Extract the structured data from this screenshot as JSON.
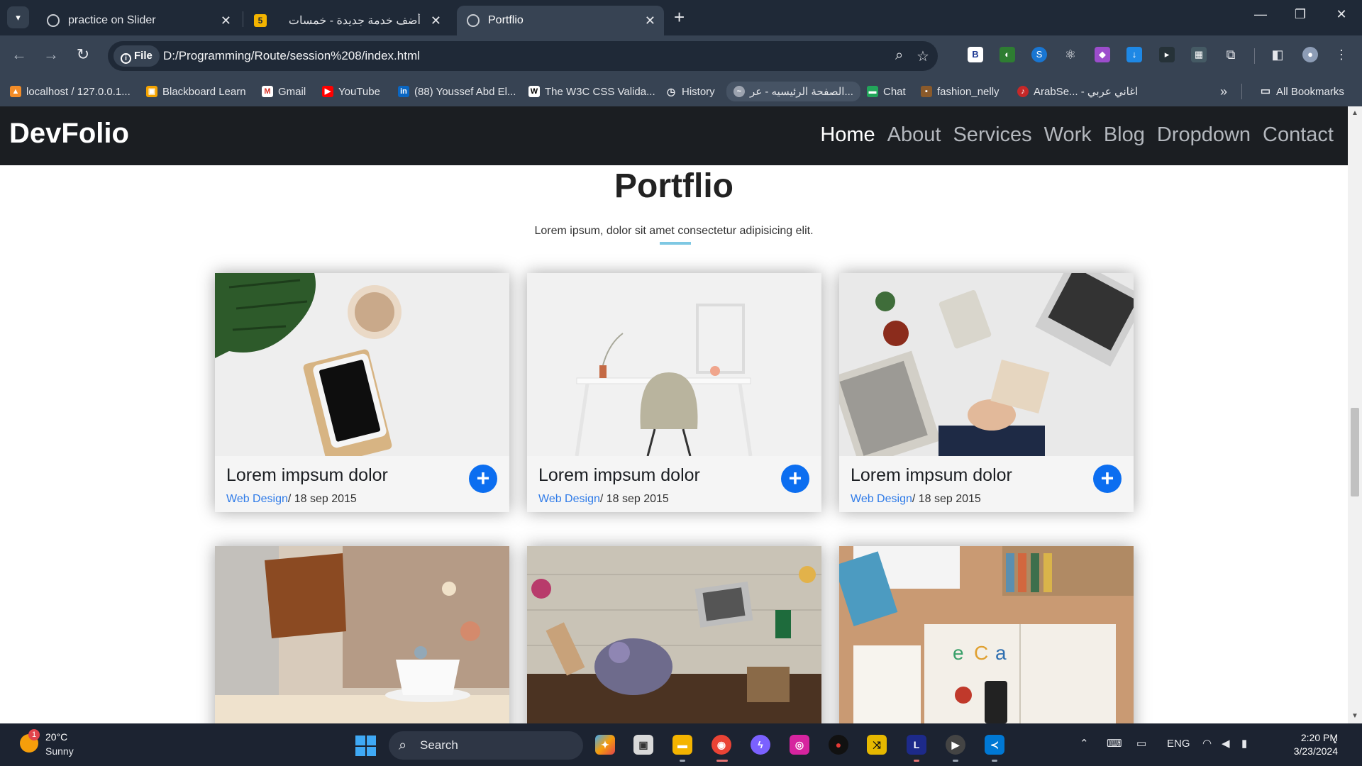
{
  "browser": {
    "tabs": [
      {
        "title": "practice on Slider",
        "active": false
      },
      {
        "title": "أضف خدمة جديدة - خمسات",
        "active": false
      },
      {
        "title": "Portflio",
        "active": true
      }
    ],
    "favicon_five": "5",
    "new_tab_symbol": "+",
    "url_chip": "File",
    "url": "D:/Programming/Route/session%208/index.html",
    "bookmarks": [
      "localhost / 127.0.0.1...",
      "Blackboard Learn",
      "Gmail",
      "YouTube",
      "(88) Youssef Abd El...",
      "The W3C CSS Valida...",
      "History",
      "الصفحة الرئيسيه - عر...",
      "Chat",
      "fashion_nelly",
      "ArabSe... - اغاني عربي"
    ],
    "all_bookmarks": "All Bookmarks",
    "extension_letter_b": "B"
  },
  "site": {
    "logo": "DevFolio",
    "nav": [
      "Home",
      "About",
      "Services",
      "Work",
      "Blog",
      "Dropdown",
      "Contact"
    ],
    "active_nav": "Home",
    "section_title": "Portflio",
    "section_subtitle": "Lorem ipsum, dolor sit amet consectetur adipisicing elit.",
    "cards": [
      {
        "title": "Lorem impsum dolor",
        "category": "Web Design",
        "date": "/ 18 sep 2015",
        "image": "tablet-monstera-coffee"
      },
      {
        "title": "Lorem impsum dolor",
        "category": "Web Design",
        "date": "/ 18 sep 2015",
        "image": "white-desk-chair"
      },
      {
        "title": "Lorem impsum dolor",
        "category": "Web Design",
        "date": "/ 18 sep 2015",
        "image": "business-desk-laptop"
      },
      {
        "title": "",
        "category": "",
        "date": "",
        "image": "laptop-bag-cup"
      },
      {
        "title": "",
        "category": "",
        "date": "",
        "image": "flowers-laptop-wood"
      },
      {
        "title": "",
        "category": "",
        "date": "",
        "image": "keyboard-books-magazine"
      }
    ],
    "plus_symbol": "+"
  },
  "taskbar": {
    "temperature": "20°C",
    "weather": "Sunny",
    "weather_badge": "1",
    "search_placeholder": "Search",
    "app_letter_l": "L",
    "language": "ENG",
    "time": "2:20 PM",
    "date": "3/23/2024"
  },
  "colors": {
    "accent_blue": "#0c6ef0",
    "link_blue": "#2f7be8",
    "nav_bg": "#1b1e22",
    "underline": "#7ec8e3"
  }
}
